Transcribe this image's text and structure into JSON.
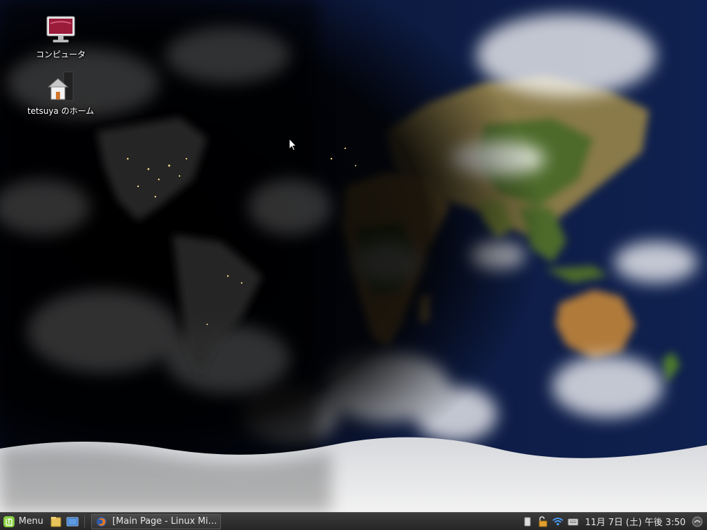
{
  "desktop": {
    "icons": [
      {
        "label": "コンピュータ",
        "icon": "computer-icon"
      },
      {
        "label": "tetsuya のホーム",
        "icon": "home-folder-icon"
      }
    ]
  },
  "panel": {
    "menu_label": "Menu",
    "launchers": [
      "files-icon",
      "show-desktop-icon"
    ],
    "task": {
      "title": "[Main Page - Linux Mi…",
      "icon": "firefox-icon"
    },
    "tray": [
      "removable-drive-icon",
      "update-manager-icon",
      "network-wifi-icon",
      "keyboard-icon"
    ],
    "clock": "11月 7日 (土) 午後 3:50",
    "end_icon": "user-session-icon"
  },
  "colors": {
    "panel_bg": "#2e2e2e",
    "mint_green": "#87cf3e",
    "ocean": "#0d1a3e"
  }
}
